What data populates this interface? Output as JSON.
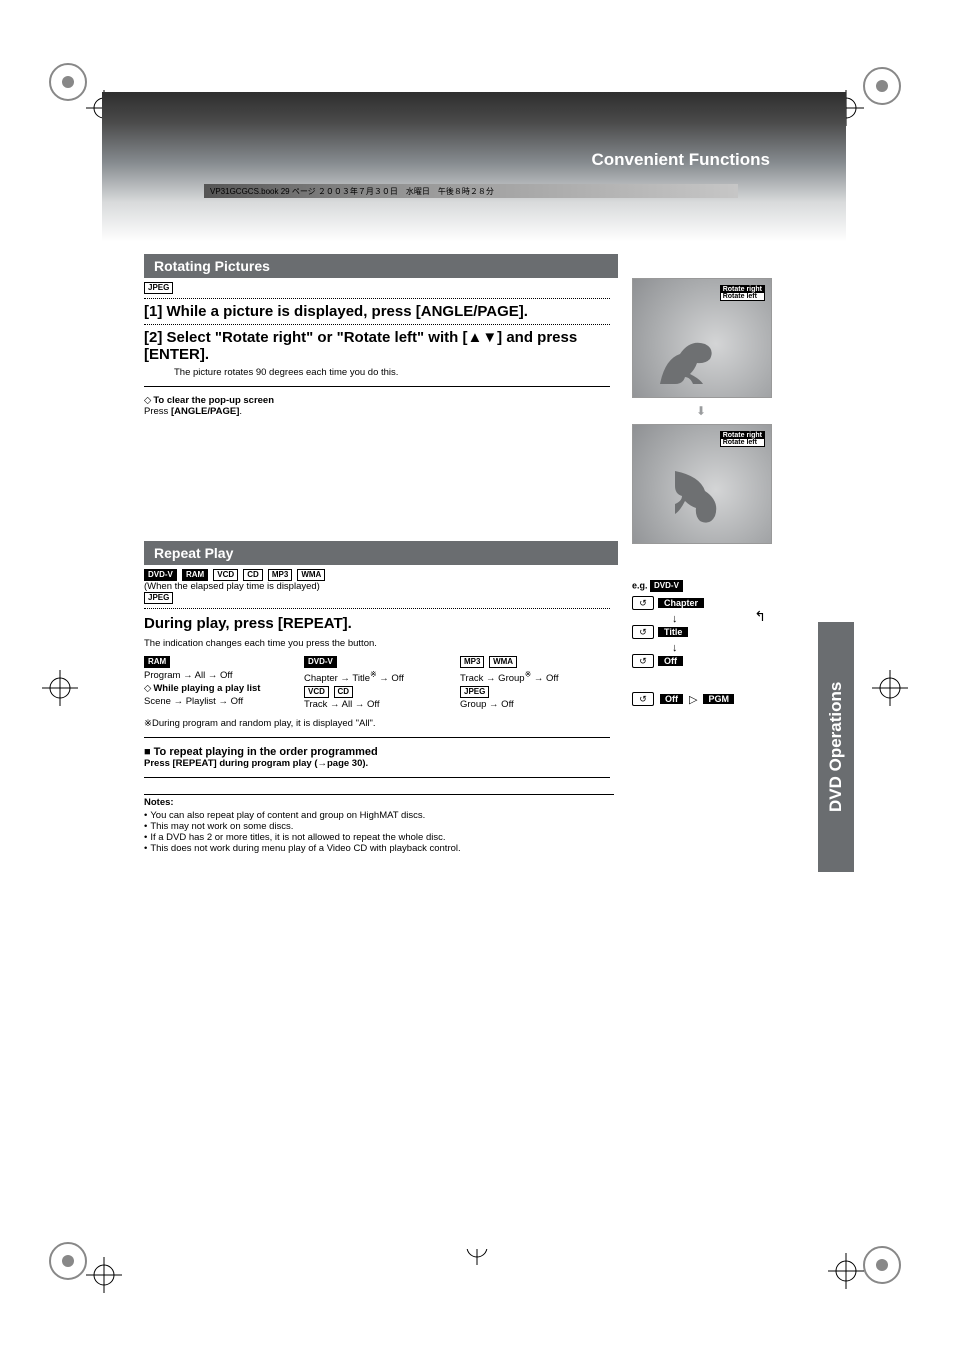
{
  "header_strip": "VP31GCGCS.book  29 ページ  ２００３年７月３０日　水曜日　午後８時２８分",
  "header_title": "Convenient Functions",
  "side_tab": "DVD Operations",
  "section1": {
    "title": "Rotating Pictures",
    "tag": "JPEG",
    "step1": "[1] While a picture is displayed, press [ANGLE/PAGE].",
    "step2_a": "[2] Select \"Rotate right\" or \"Rotate left\" with [",
    "step2_b": "] and press [ENTER].",
    "step2_note": "The picture rotates 90 degrees each time you do this.",
    "clear_head": "To clear the pop-up screen",
    "clear_body_a": "Press ",
    "clear_body_b": "[ANGLE/PAGE]",
    "clear_body_c": "."
  },
  "illus": {
    "rot_right": "Rotate right",
    "rot_left": "Rotate left"
  },
  "section2": {
    "title": "Repeat Play",
    "tags": [
      "DVD-V",
      "RAM",
      "VCD",
      "CD",
      "MP3",
      "WMA"
    ],
    "elapsed_note": "(When the elapsed play time is displayed)",
    "tag_jpeg": "JPEG",
    "subhead": "During play, press [REPEAT].",
    "indication": "The indication changes each time you press the button.",
    "col1": {
      "tag": "RAM",
      "line1": "Program → All → Off",
      "play_head": "While playing a play list",
      "line2": "Scene → Playlist → Off"
    },
    "col2": {
      "tag1": "DVD-V",
      "line1_a": "Chapter → Title",
      "line1_sup": "※",
      "line1_b": " → Off",
      "tag2a": "VCD",
      "tag2b": "CD",
      "line2": "Track → All → Off"
    },
    "col3": {
      "tag1a": "MP3",
      "tag1b": "WMA",
      "line1_a": "Track → Group",
      "line1_sup": "※",
      "line1_b": " → Off",
      "tag2": "JPEG",
      "line2": "Group → Off"
    },
    "footnote": "※During program and random play, it is displayed \"All\".",
    "repeat_prog_head": "To repeat playing in the order programmed",
    "repeat_prog_body": "Press [REPEAT] during program play (→page 30)."
  },
  "eg": {
    "label": "e.g.",
    "tag": "DVD-V",
    "chapter": "Chapter",
    "title": "Title",
    "off": "Off",
    "off2": "Off",
    "pgm": "PGM"
  },
  "notes": {
    "head": "Notes:",
    "items": [
      "You can also repeat play of content and group on HighMAT discs.",
      "This may not work on some discs.",
      "If a DVD has 2 or more titles, it is not allowed to repeat the whole disc.",
      "This does not work during menu play of a Video CD with playback control."
    ]
  }
}
